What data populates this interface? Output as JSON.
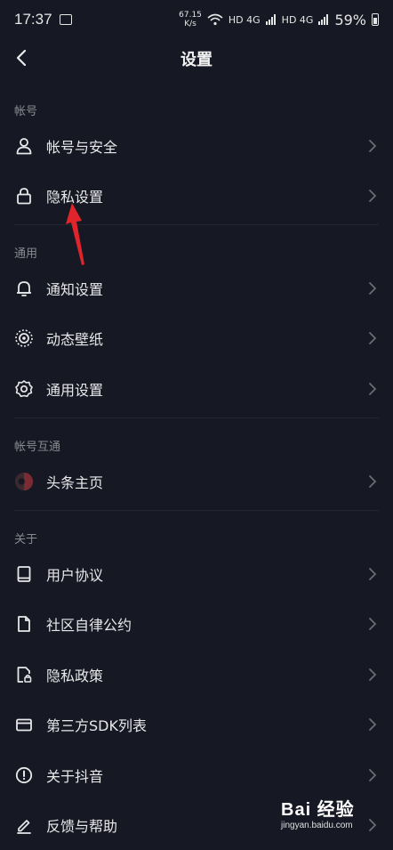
{
  "status": {
    "time": "17:37",
    "speed_value": "67.15",
    "speed_unit": "K/s",
    "network_a": "HD 4G",
    "network_b": "HD 4G",
    "battery": "59%"
  },
  "nav": {
    "title": "设置",
    "back_icon": "chevron-left-icon"
  },
  "sections": [
    {
      "label": "帐号",
      "items": [
        {
          "label": "帐号与安全",
          "icon": "user-icon"
        },
        {
          "label": "隐私设置",
          "icon": "lock-icon"
        }
      ]
    },
    {
      "label": "通用",
      "items": [
        {
          "label": "通知设置",
          "icon": "bell-icon"
        },
        {
          "label": "动态壁纸",
          "icon": "wallpaper-icon"
        },
        {
          "label": "通用设置",
          "icon": "gear-icon"
        }
      ]
    },
    {
      "label": "帐号互通",
      "items": [
        {
          "label": "头条主页",
          "icon": "toutiao-avatar-icon"
        }
      ]
    },
    {
      "label": "关于",
      "items": [
        {
          "label": "用户协议",
          "icon": "book-icon"
        },
        {
          "label": "社区自律公约",
          "icon": "document-icon"
        },
        {
          "label": "隐私政策",
          "icon": "privacy-doc-icon"
        },
        {
          "label": "第三方SDK列表",
          "icon": "card-icon"
        },
        {
          "label": "关于抖音",
          "icon": "info-icon"
        },
        {
          "label": "反馈与帮助",
          "icon": "edit-icon"
        }
      ]
    }
  ],
  "watermark": {
    "brand": "Bai 经验",
    "site": "jingyan.baidu.com"
  },
  "colors": {
    "background": "#161823",
    "text": "#e8e8ea",
    "muted": "#8a8b91",
    "annotation_arrow": "#e0242b"
  }
}
